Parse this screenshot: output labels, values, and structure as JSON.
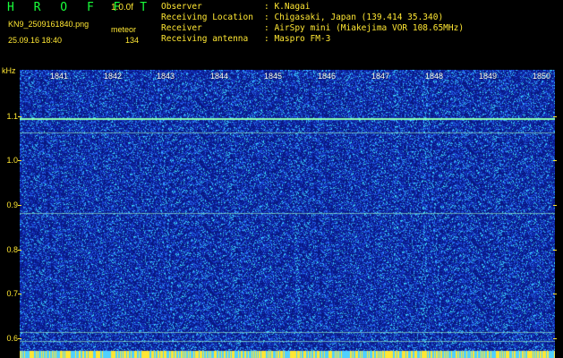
{
  "header": {
    "logo": "H R O F F T",
    "version": "1.0.0f",
    "filename": "KN9_2509161840.png",
    "mode": "meteor",
    "datetime": "25.09.16 18:40",
    "count": "134"
  },
  "station_info": [
    {
      "key": "Observer",
      "value": ": K.Nagai"
    },
    {
      "key": "Receiving Location",
      "value": ": Chigasaki, Japan (139.414 35.340)"
    },
    {
      "key": "Receiver",
      "value": ": AirSpy mini (Miakejima VOR 108.65MHz)"
    },
    {
      "key": "Receiving antenna",
      "value": ": Maspro FM-3"
    }
  ],
  "plot": {
    "y_unit": "kHz",
    "y_ticks": [
      "1.1",
      "1.0",
      "0.9",
      "0.8",
      "0.7",
      "0.6"
    ],
    "x_ticks": [
      "1841",
      "1842",
      "1843",
      "1844",
      "1845",
      "1846",
      "1847",
      "1848",
      "1849",
      "1850"
    ],
    "colors": {
      "background": "#0a1a8a",
      "noise_low": "#1a3fd0",
      "noise_high": "#30e0ff",
      "signal": "#5cff9a",
      "text": "#ffe733"
    }
  }
}
